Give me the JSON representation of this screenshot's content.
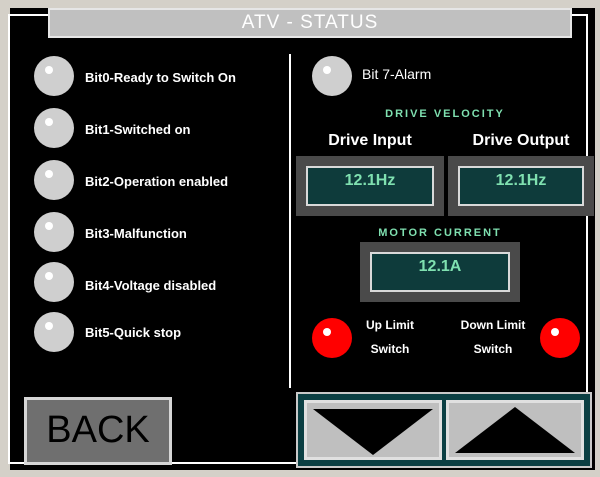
{
  "title": "ATV - STATUS",
  "left_bits": [
    {
      "label": "Bit0-Ready to Switch On",
      "led": "off"
    },
    {
      "label": "Bit1-Switched on",
      "led": "off"
    },
    {
      "label": "Bit2-Operation enabled",
      "led": "off"
    },
    {
      "label": "Bit3-Malfunction",
      "led": "off"
    },
    {
      "label": "Bit4-Voltage disabled",
      "led": "off"
    },
    {
      "label": "Bit5-Quick stop",
      "led": "off"
    }
  ],
  "alarm": {
    "label": "Bit 7-Alarm",
    "led": "off"
  },
  "drive_velocity": {
    "heading": "DRIVE VELOCITY",
    "input_label": "Drive Input",
    "output_label": "Drive Output",
    "input_value": "12.1Hz",
    "output_value": "12.1Hz"
  },
  "motor_current": {
    "heading": "MOTOR CURRENT",
    "value": "12.1A"
  },
  "limits": {
    "up_line1": "Up Limit",
    "up_line2": "Switch",
    "down_line1": "Down Limit",
    "down_line2": "Switch",
    "up_led": "red",
    "down_led": "red"
  },
  "back_label": "BACK",
  "nav": {
    "down_icon": "triangle-down-icon",
    "up_icon": "triangle-up-icon"
  },
  "colors": {
    "screen": "#000000",
    "value_text": "#7fe0b0",
    "led_off": "#cfcfcf",
    "led_on": "#ff0000"
  }
}
